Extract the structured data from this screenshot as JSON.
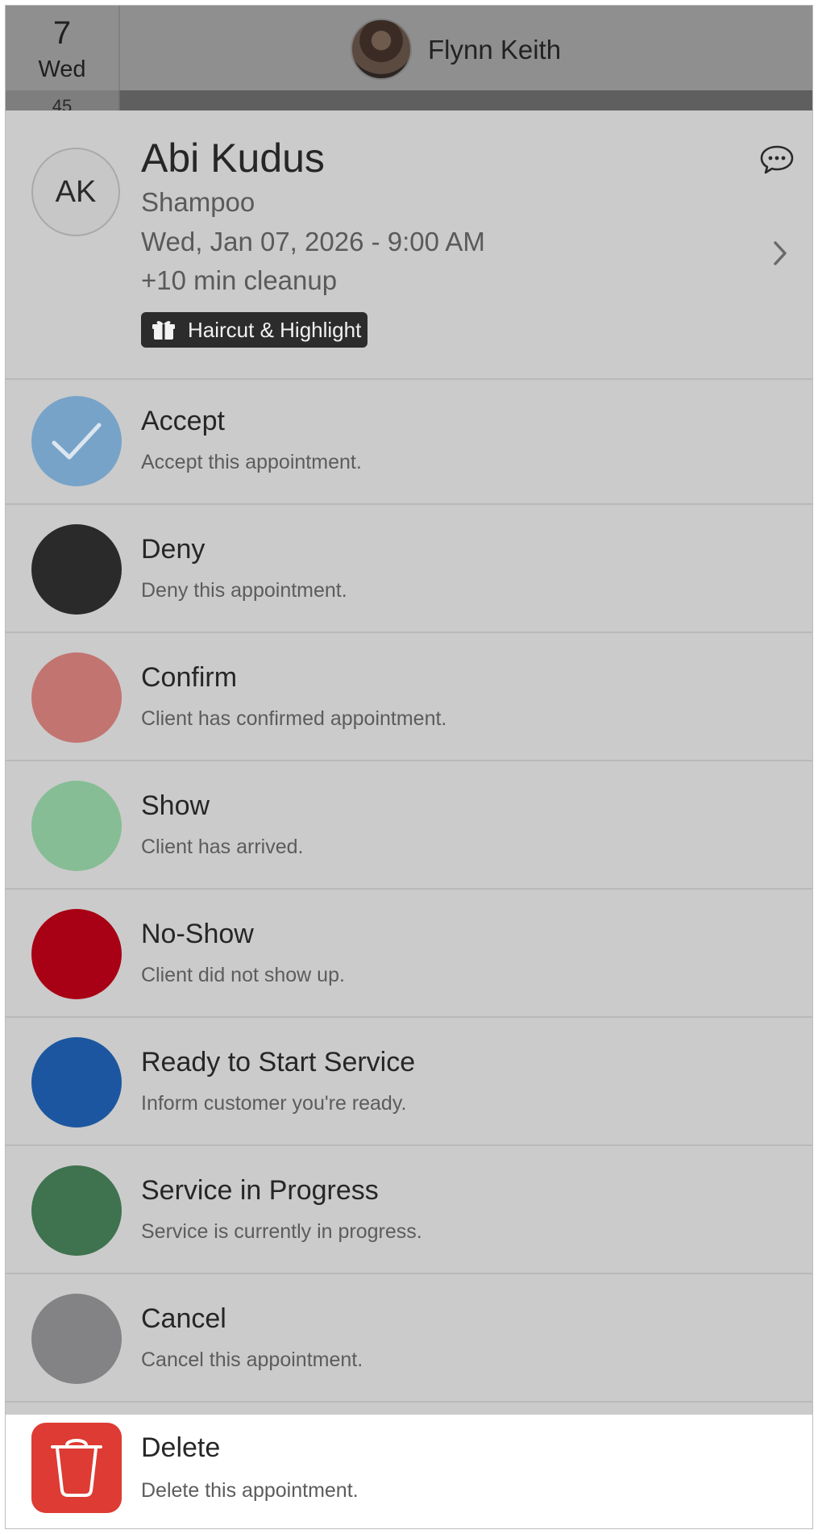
{
  "calendar": {
    "day_number": "7",
    "day_name": "Wed",
    "time_partial": "45",
    "staff_name": "Flynn Keith"
  },
  "appointment": {
    "initials": "AK",
    "client_name": "Abi Kudus",
    "service": "Shampoo",
    "datetime": "Wed, Jan 07, 2026 - 9:00 AM",
    "cleanup": "+10 min cleanup",
    "package_tag": "Haircut & Highlight"
  },
  "actions": [
    {
      "title": "Accept",
      "desc": "Accept this appointment.",
      "color": "#77a3c9",
      "icon": "checkmark-icon"
    },
    {
      "title": "Deny",
      "desc": "Deny this appointment.",
      "color": "#2a2a2a",
      "icon": ""
    },
    {
      "title": "Confirm",
      "desc": "Client has confirmed appointment.",
      "color": "#c27470",
      "icon": ""
    },
    {
      "title": "Show",
      "desc": "Client has arrived.",
      "color": "#86bd95",
      "icon": ""
    },
    {
      "title": "No-Show",
      "desc": "Client did not show up.",
      "color": "#a80014",
      "icon": ""
    },
    {
      "title": "Ready to Start Service",
      "desc": "Inform customer you're ready.",
      "color": "#1c56a0",
      "icon": ""
    },
    {
      "title": "Service in Progress",
      "desc": "Service is currently in progress.",
      "color": "#3f724f",
      "icon": ""
    },
    {
      "title": "Cancel",
      "desc": "Cancel this appointment.",
      "color": "#838284",
      "icon": ""
    },
    {
      "title": "Delete",
      "desc": "Delete this appointment.",
      "color": "#dd3b33",
      "icon": "trash-icon"
    }
  ]
}
